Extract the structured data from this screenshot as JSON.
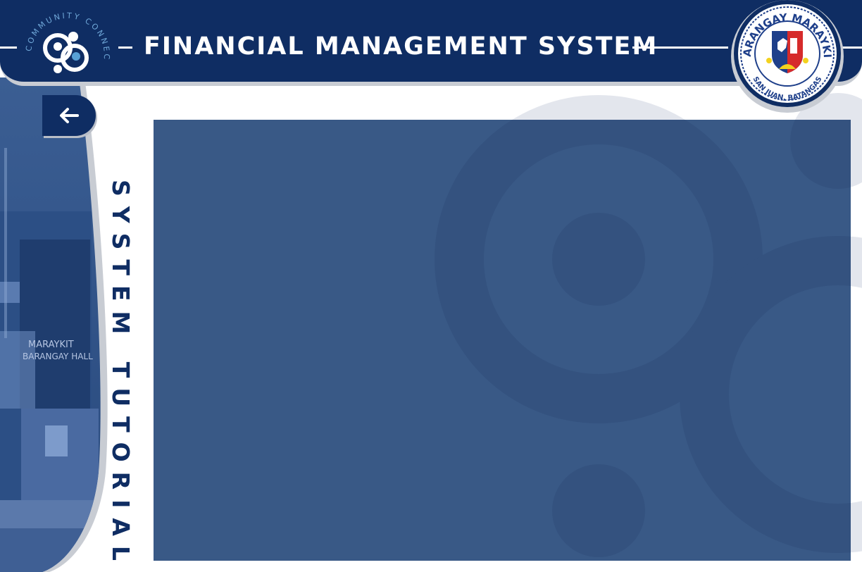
{
  "header": {
    "title": "FINANCIAL MANAGEMENT SYSTEM",
    "logo_text": "COMMUNITY CONNECT",
    "seal": {
      "top_text": "BARANGAY MARAYKIT",
      "bottom_text": "SAN JUAN, BATANGAS"
    }
  },
  "sidebar": {
    "back_icon": "arrow-left-icon",
    "photo_signage": [
      "MARAYKIT",
      "BARANGAY HALL"
    ],
    "vertical_title": "SYSTEM TUTORIAL"
  },
  "main": {
    "panel_icon": "community-connect-watermark"
  },
  "colors": {
    "navy": "#0f2d63",
    "panel": "#395986",
    "watermark": "#e3e6ed",
    "shadow": "#c8ccd3"
  }
}
